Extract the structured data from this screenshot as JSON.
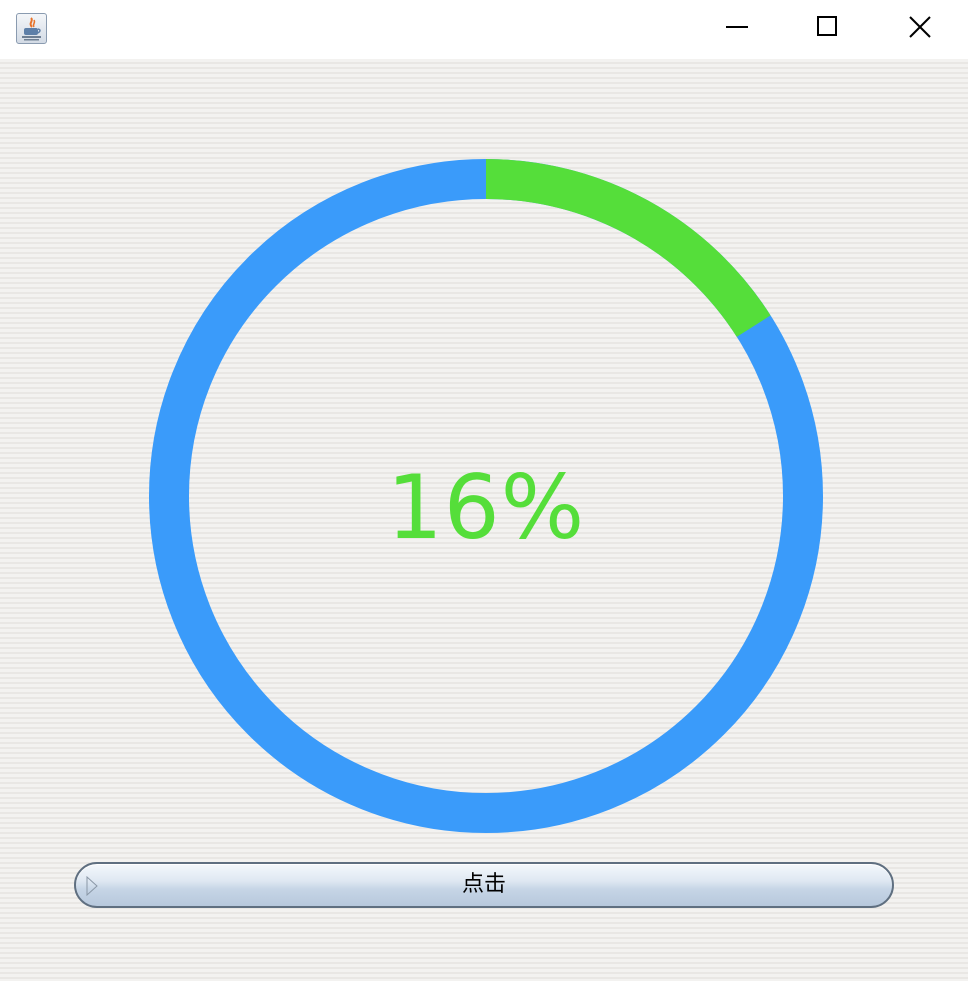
{
  "window": {
    "title": "",
    "app_icon": "java-cup-icon",
    "controls": [
      "minimize-icon",
      "maximize-icon",
      "close-icon"
    ]
  },
  "progress": {
    "percent": 16,
    "label": "16%",
    "track_color": "#3a9bfa",
    "fill_color": "#55de3a",
    "text_color": "#55de3a"
  },
  "button": {
    "label": "点击"
  }
}
